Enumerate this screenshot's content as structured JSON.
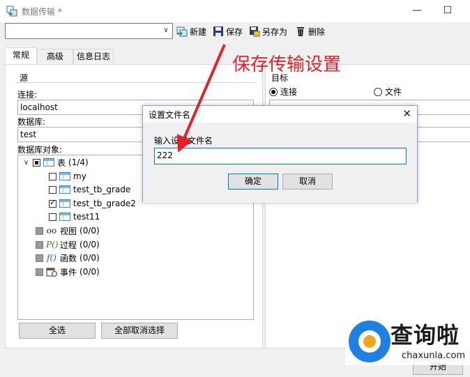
{
  "window": {
    "title": "数据传输 *"
  },
  "toolbar": {
    "profile_value": "",
    "new_label": "新建",
    "save_label": "保存",
    "save_as_label": "另存为",
    "delete_label": "删除"
  },
  "tabs": [
    {
      "label": "常规"
    },
    {
      "label": "高级"
    },
    {
      "label": "信息日志"
    }
  ],
  "source": {
    "group_title": "源",
    "connection_label": "连接:",
    "connection_value": "localhost",
    "database_label": "数据库:",
    "database_value": "test",
    "objects_label": "数据库对象:",
    "tree": {
      "tables": {
        "label": "表",
        "count": "(1/4)"
      },
      "table_items": [
        {
          "label": "my",
          "checked": false
        },
        {
          "label": "test_tb_grade",
          "checked": false
        },
        {
          "label": "test_tb_grade2",
          "checked": true
        },
        {
          "label": "test11",
          "checked": false
        }
      ],
      "views": {
        "label": "视图",
        "count": "(0/0)"
      },
      "procedures": {
        "label": "过程",
        "count": "(0/0)"
      },
      "functions": {
        "label": "函数",
        "count": "(0/0)"
      },
      "events": {
        "label": "事件",
        "count": "(0/0)"
      }
    },
    "select_all_label": "全选",
    "deselect_all_label": "全部取消选择"
  },
  "target": {
    "group_title": "目标",
    "option_connection": "连接",
    "option_file": "文件",
    "selected": "连接"
  },
  "dialog": {
    "title": "设置文件名",
    "prompt": "输入设置文件名",
    "input_value": "222",
    "ok_label": "确定",
    "cancel_label": "取消"
  },
  "annotation": {
    "text": "保存传输设置",
    "color": "#e0232a"
  },
  "footer": {
    "start_label": "开始"
  },
  "watermark": {
    "brand": "查询啦",
    "domain": "chaxunla.com",
    "color": "#1f7fe3"
  }
}
